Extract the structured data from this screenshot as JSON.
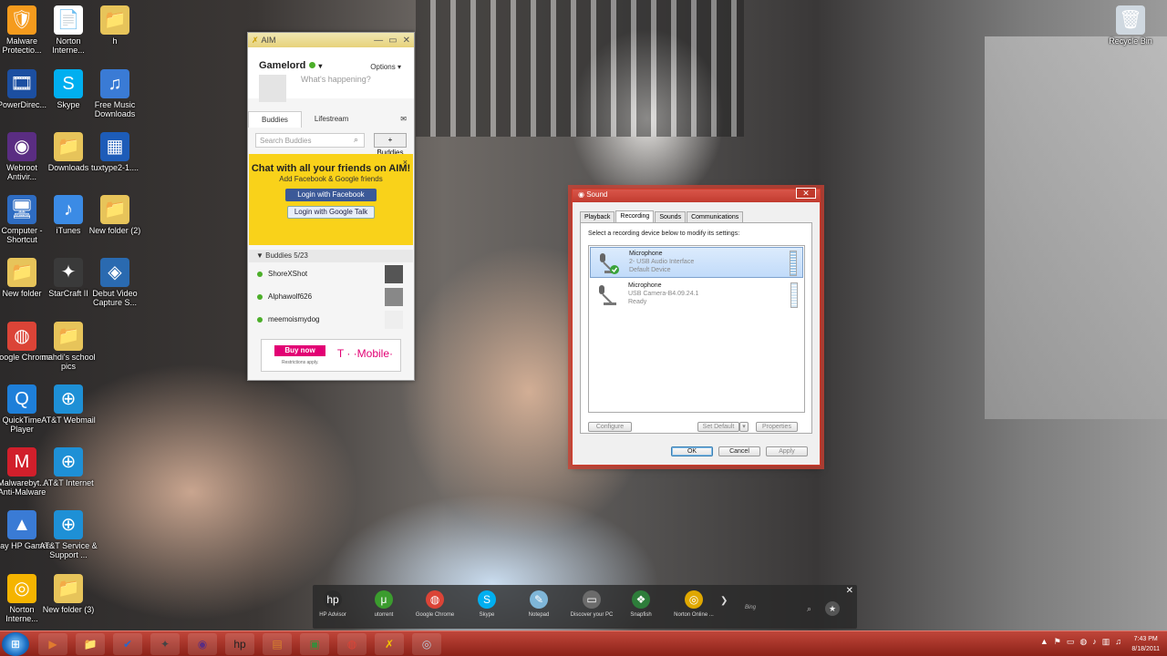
{
  "desktop": {
    "icons": [
      {
        "label": "Malware Protectio...",
        "icon": "malware-protection-icon",
        "color": "#f59b1d",
        "glyph": "🛡"
      },
      {
        "label": "Norton Interne...",
        "icon": "document-icon",
        "color": "#ffffff",
        "glyph": "📄"
      },
      {
        "label": "h",
        "icon": "folder-icon",
        "color": "#e7c45a",
        "glyph": "📁"
      },
      {
        "label": "PowerDirec...",
        "icon": "powerdirector-icon",
        "color": "#1c4fa1",
        "glyph": "🎞"
      },
      {
        "label": "Skype",
        "icon": "skype-icon",
        "color": "#00aff0",
        "glyph": "S"
      },
      {
        "label": "Free Music Downloads",
        "icon": "music-note-icon",
        "color": "#3a7bd5",
        "glyph": "♫"
      },
      {
        "label": "Webroot Antivir...",
        "icon": "webroot-icon",
        "color": "#5a2d82",
        "glyph": "◉"
      },
      {
        "label": "Downloads",
        "icon": "folder-icon",
        "color": "#e7c45a",
        "glyph": "📁"
      },
      {
        "label": "tuxtype2-1....",
        "icon": "file-icon",
        "color": "#1d5cb8",
        "glyph": "▦"
      },
      {
        "label": "Computer - Shortcut",
        "icon": "computer-icon",
        "color": "#2e6cc2",
        "glyph": "🖥"
      },
      {
        "label": "iTunes",
        "icon": "itunes-icon",
        "color": "#3b8be5",
        "glyph": "♪"
      },
      {
        "label": "New folder (2)",
        "icon": "folder-icon",
        "color": "#e7c45a",
        "glyph": "📁"
      },
      {
        "label": "New folder",
        "icon": "folder-icon",
        "color": "#e7c45a",
        "glyph": "📁"
      },
      {
        "label": "StarCraft II",
        "icon": "starcraft-icon",
        "color": "#3a3a3a",
        "glyph": "✦"
      },
      {
        "label": "Debut Video Capture S...",
        "icon": "video-capture-icon",
        "color": "#2a6ab0",
        "glyph": "◈"
      },
      {
        "label": "Google Chrome",
        "icon": "chrome-icon",
        "color": "#db4437",
        "glyph": "◍"
      },
      {
        "label": "mahdi's school pics",
        "icon": "folder-icon",
        "color": "#e7c45a",
        "glyph": "📁"
      },
      {
        "label": "QuickTime Player",
        "icon": "quicktime-icon",
        "color": "#1e7fd9",
        "glyph": "Q"
      },
      {
        "label": "AT&T Webmail",
        "icon": "att-icon",
        "color": "#1e90d6",
        "glyph": "⊕"
      },
      {
        "label": "Malwarebyt... Anti-Malware",
        "icon": "malwarebytes-icon",
        "color": "#d11f2b",
        "glyph": "M"
      },
      {
        "label": "AT&T Internet",
        "icon": "att-icon",
        "color": "#1e90d6",
        "glyph": "⊕"
      },
      {
        "label": "Play HP Games",
        "icon": "hp-games-icon",
        "color": "#3a7bd5",
        "glyph": "▲"
      },
      {
        "label": "AT&T Service & Support ...",
        "icon": "att-icon",
        "color": "#1e90d6",
        "glyph": "⊕"
      },
      {
        "label": "Norton Interne...",
        "icon": "norton-icon",
        "color": "#f5b400",
        "glyph": "◎"
      },
      {
        "label": "New folder (3)",
        "icon": "folder-icon",
        "color": "#e7c45a",
        "glyph": "📁"
      },
      {
        "label": "Recycle Bin",
        "icon": "recycle-bin-icon",
        "color": "#cfd8e0",
        "glyph": "🗑"
      }
    ]
  },
  "aim": {
    "title": "AIM",
    "username": "Gamelord",
    "options_label": "Options ▾",
    "status_placeholder": "What's happening?",
    "tabs": [
      "Buddies",
      "Lifestream"
    ],
    "search_placeholder": "Search Buddies",
    "add_buddies_label": "+ Buddies",
    "promo": {
      "headline": "Chat with all your friends on AIM!",
      "subline": "Add Facebook & Google friends",
      "facebook_button": "Login with Facebook",
      "google_button": "Login with Google Talk",
      "close": "×"
    },
    "buddies_header": "▼ Buddies 5/23",
    "buddies": [
      "ShoreXShot",
      "Alphawolf626",
      "meemoismydog"
    ],
    "ad": {
      "buy_label": "Buy now",
      "restrictions": "Restrictions apply.",
      "brand": "T · ·Mobile·"
    },
    "window_controls": [
      "—",
      "▭",
      "✕"
    ]
  },
  "sound": {
    "title": "Sound",
    "tabs": [
      "Playback",
      "Recording",
      "Sounds",
      "Communications"
    ],
    "active_tab": "Recording",
    "instruction": "Select a recording device below to modify its settings:",
    "devices": [
      {
        "name": "Microphone",
        "detail": "2- USB Audio Interface",
        "status": "Default Device",
        "selected": true
      },
      {
        "name": "Microphone",
        "detail": "USB Camera-B4.09.24.1",
        "status": "Ready",
        "selected": false
      }
    ],
    "buttons": {
      "configure": "Configure",
      "set_default": "Set Default",
      "set_default_arrow": "▾",
      "properties": "Properties",
      "ok": "OK",
      "cancel": "Cancel",
      "apply": "Apply"
    },
    "close": "✕"
  },
  "dock": {
    "items": [
      {
        "label": "HP Advisor",
        "icon": "hp-icon",
        "color": "#2b2b2b",
        "glyph": "hp"
      },
      {
        "label": "utorrent",
        "icon": "utorrent-icon",
        "color": "#3b9c2e",
        "glyph": "μ"
      },
      {
        "label": "Google Chrome",
        "icon": "chrome-icon",
        "color": "#db4437",
        "glyph": "◍"
      },
      {
        "label": "Skype",
        "icon": "skype-icon",
        "color": "#00aff0",
        "glyph": "S"
      },
      {
        "label": "Notepad",
        "icon": "notepad-icon",
        "color": "#7fb6d8",
        "glyph": "✎"
      },
      {
        "label": "Discover your PC",
        "icon": "discover-pc-icon",
        "color": "#6b6b6b",
        "glyph": "▭"
      },
      {
        "label": "Snapfish",
        "icon": "snapfish-icon",
        "color": "#2d7d3a",
        "glyph": "❖"
      },
      {
        "label": "Norton Online ...",
        "icon": "norton-icon",
        "color": "#e0a800",
        "glyph": "◎"
      }
    ],
    "more": "❯",
    "bing_placeholder": "Bing",
    "close": "✕"
  },
  "taskbar": {
    "start_glyph": "⊞",
    "items": [
      {
        "icon": "windows-media-icon",
        "color": "#e07a2f",
        "glyph": "▶"
      },
      {
        "icon": "explorer-folder-icon",
        "color": "#e7c45a",
        "glyph": "📁"
      },
      {
        "icon": "checkmark-app-icon",
        "color": "#2a66c9",
        "glyph": "✔"
      },
      {
        "icon": "starcraft-icon",
        "color": "#444444",
        "glyph": "✦"
      },
      {
        "icon": "webroot-icon",
        "color": "#5a2d82",
        "glyph": "◉"
      },
      {
        "icon": "hp-icon",
        "color": "#222222",
        "glyph": "hp"
      },
      {
        "icon": "file-manager-icon",
        "color": "#d9822b",
        "glyph": "▤"
      },
      {
        "icon": "camera-app-icon",
        "color": "#3c8a3c",
        "glyph": "▣"
      },
      {
        "icon": "chrome-icon",
        "color": "#db4437",
        "glyph": "◍"
      },
      {
        "icon": "aim-icon",
        "color": "#f5c400",
        "glyph": "✗"
      },
      {
        "icon": "sound-icon",
        "color": "#b9c9d9",
        "glyph": "◎"
      }
    ],
    "tray_icons": [
      "▲",
      "⚑",
      "▭",
      "◍",
      "♪",
      "▥",
      "♫"
    ],
    "time": "7:43 PM",
    "date": "8/18/2011"
  },
  "colors": {
    "taskbar": "#a8372b",
    "aim_promo": "#f9d21a",
    "selection": "#c1dbfa",
    "facebook": "#3b5998",
    "tmobile": "#e20074"
  }
}
